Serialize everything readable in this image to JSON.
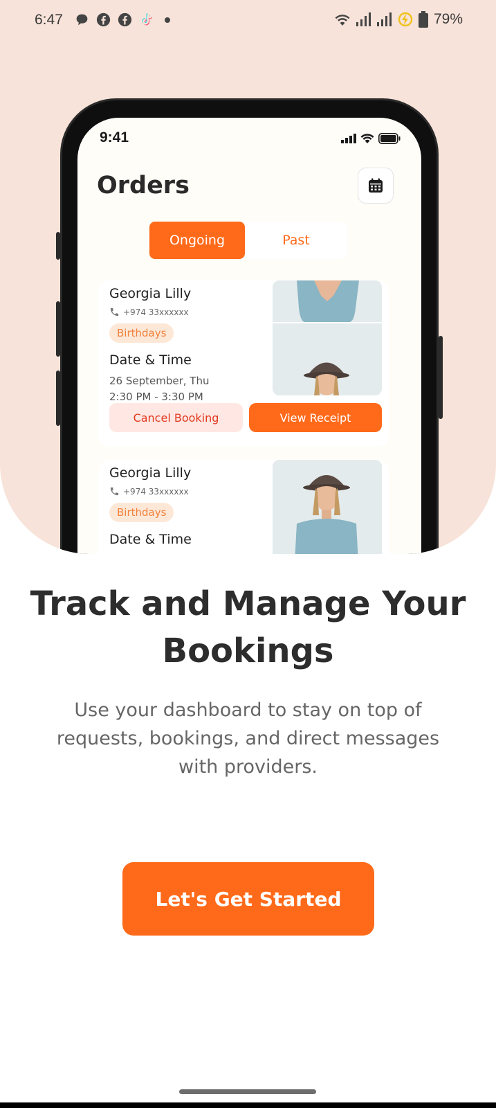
{
  "statusbar": {
    "time": "6:47",
    "battery": "79%",
    "left_icons": [
      "chat-bubble-icon",
      "facebook-icon",
      "facebook-icon",
      "tiktok-icon"
    ],
    "right_icons": [
      "wifi-icon",
      "signal-icon",
      "signal-icon",
      "charging-icon",
      "battery-icon"
    ]
  },
  "mockup": {
    "status_time": "9:41",
    "title": "Orders",
    "tabs": [
      {
        "label": "Ongoing",
        "active": true
      },
      {
        "label": "Past",
        "active": false
      }
    ],
    "orders": [
      {
        "name": "Georgia Lilly",
        "phone": "+974 33xxxxxx",
        "tag": "Birthdays",
        "datetime_label": "Date & Time",
        "date": "26 September, Thu",
        "time": "2:30 PM - 3:30 PM",
        "cancel_label": "Cancel Booking",
        "receipt_label": "View Receipt"
      },
      {
        "name": "Georgia Lilly",
        "phone": "+974 33xxxxxx",
        "tag": "Birthdays",
        "datetime_label": "Date & Time"
      }
    ]
  },
  "content": {
    "headline": "Track and Manage Your Bookings",
    "subtext": "Use your dashboard to stay on top of requests, bookings, and direct messages with providers.",
    "cta_label": "Let's Get Started"
  },
  "colors": {
    "accent": "#ff6a1a",
    "hero_bg": "#f7e3d9",
    "tag_bg": "#fde8d8",
    "cancel_bg": "#ffe8e4"
  }
}
